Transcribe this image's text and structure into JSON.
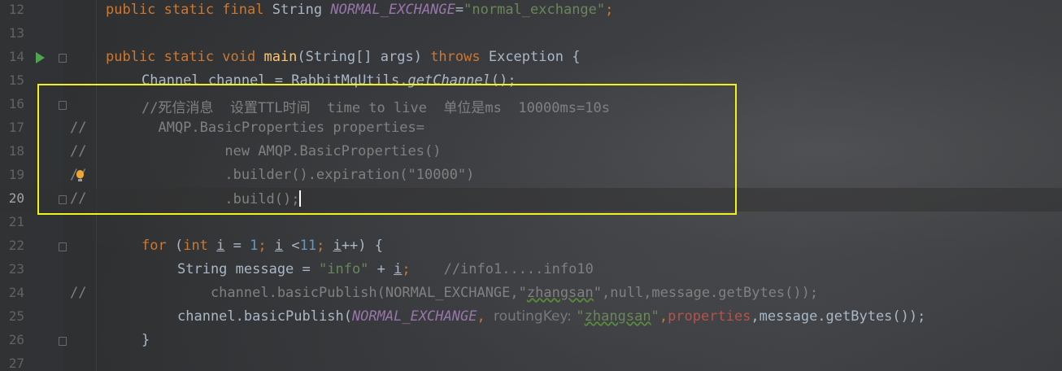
{
  "lines": {
    "l12": {
      "num": "12",
      "t1": "public static final ",
      "t2": "String ",
      "t3": "NORMAL_EXCHANGE",
      "t4": "=",
      "t5": "\"normal_exchange\"",
      "t6": ";"
    },
    "l13": {
      "num": "13"
    },
    "l14": {
      "num": "14",
      "t1": "public static void ",
      "t2": "main",
      "t3": "(String[] args) ",
      "t4": "throws ",
      "t5": "Exception {"
    },
    "l15": {
      "num": "15",
      "t1": "Channel channel = RabbitMqUtils.",
      "t2": "getChannel",
      "t3": "();"
    },
    "l16": {
      "num": "16",
      "t1": "//死信消息  设置TTL时间  time to live  单位是ms  10000ms=10s"
    },
    "l17": {
      "num": "17",
      "mark": "//",
      "t1": "  AMQP.BasicProperties properties="
    },
    "l18": {
      "num": "18",
      "mark": "//",
      "t1": "          new AMQP.BasicProperties()"
    },
    "l19": {
      "num": "19",
      "mark": "//",
      "t1": "          .builder().expiration(\"10000\")"
    },
    "l20": {
      "num": "20",
      "mark": "//",
      "t1": "          .build();"
    },
    "l21": {
      "num": "21"
    },
    "l22": {
      "num": "22",
      "t1": "for ",
      "t2": "(",
      "t3": "int ",
      "t4": "i",
      "t5": " = ",
      "t6": "1",
      "t7": "; ",
      "t8": "i",
      "t9": " <",
      "t10": "11",
      "t11": "; ",
      "t12": "i",
      "t13": "++) {"
    },
    "l23": {
      "num": "23",
      "t1": "String message = ",
      "t2": "\"info\"",
      "t3": " + ",
      "t4": "i",
      "t5": ";    ",
      "t6": "//info1.....info10"
    },
    "l24": {
      "num": "24",
      "mark": "//",
      "t1": "    channel.basicPublish(NORMAL_EXCHANGE,\"",
      "t2": "zhangsan",
      "t3": "\",null,message.getBytes());"
    },
    "l25": {
      "num": "25",
      "t1": "channel.basicPublish(",
      "t2": "NORMAL_EXCHANGE",
      "t3": ", ",
      "t4": "routingKey: ",
      "t5": "\"",
      "t6": "zhangsan",
      "t7": "\"",
      "t8": ",",
      "t9": "properties",
      "t10": ",message.getBytes());"
    },
    "l26": {
      "num": "26",
      "t1": "}"
    },
    "l27": {
      "num": "27"
    }
  },
  "colors": {
    "keyword": "#cc7832",
    "string": "#6a8759",
    "constant": "#9876aa",
    "method": "#ffc66d",
    "number": "#6897bb",
    "comment": "#808080",
    "highlight": "#f2f21a"
  },
  "icons": [
    "run-icon",
    "fold-icon",
    "lightbulb-icon"
  ]
}
